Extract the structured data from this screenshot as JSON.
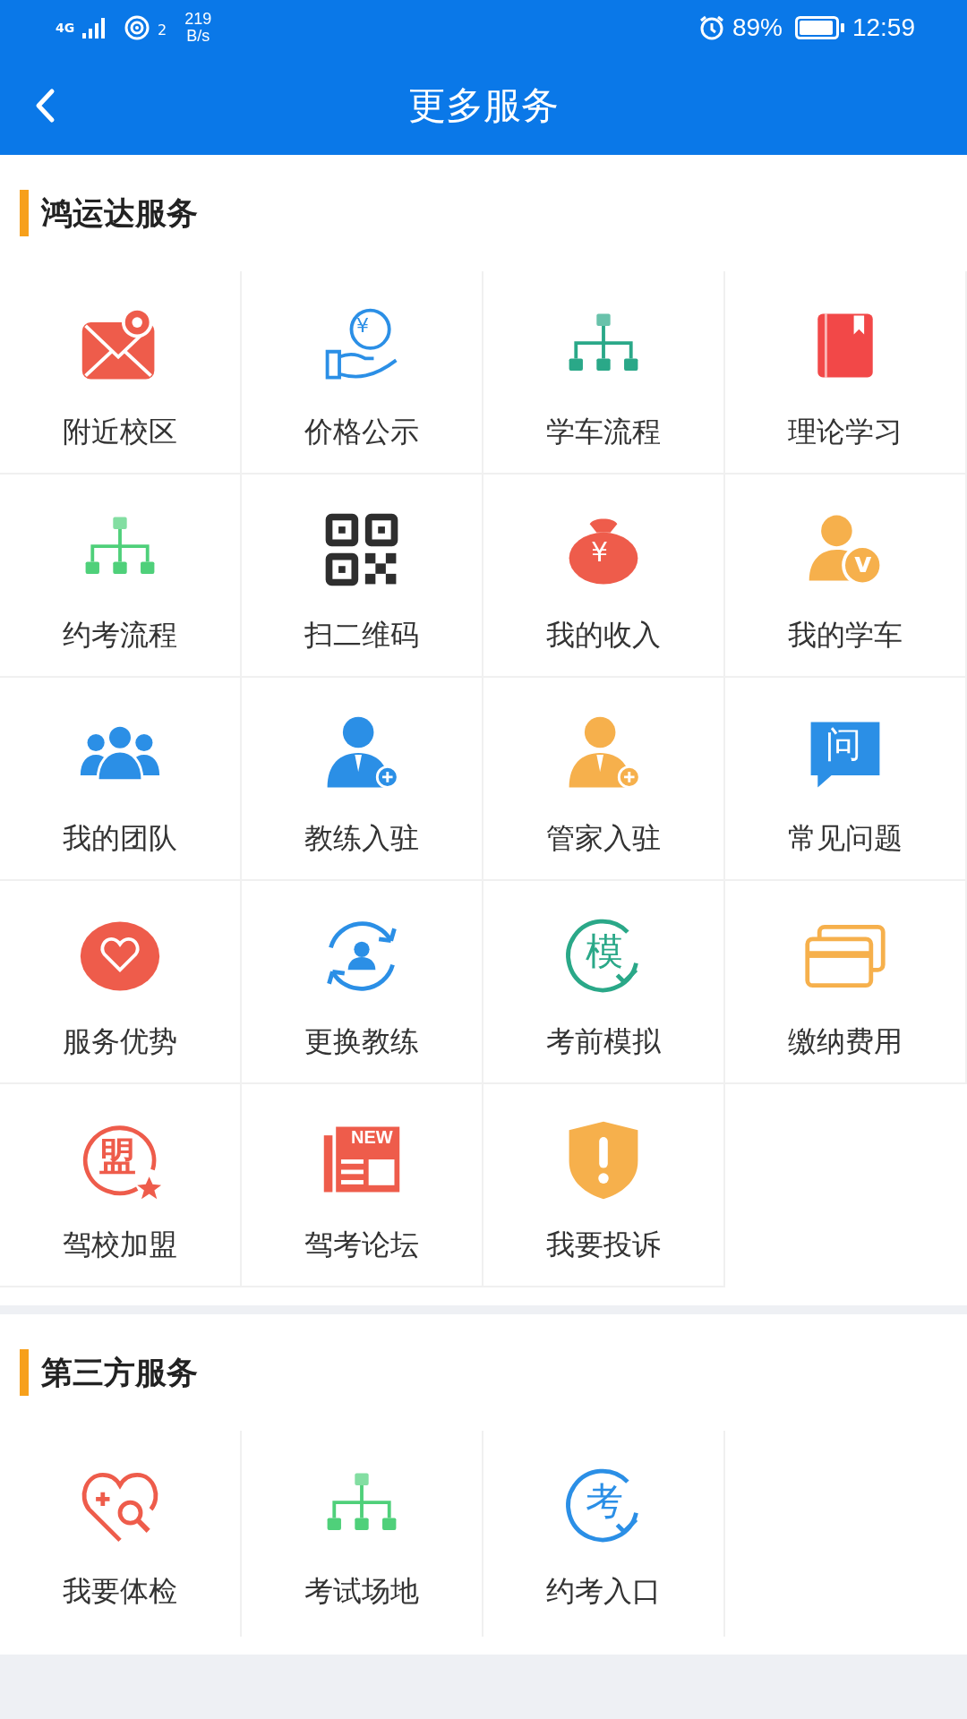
{
  "status_bar": {
    "network": "4G",
    "wifi_sub": "2",
    "speed": "219",
    "speed_unit": "B/s",
    "battery": "89%",
    "time": "12:59"
  },
  "header": {
    "title": "更多服务"
  },
  "sections": [
    {
      "title": "鸿运达服务",
      "items": [
        {
          "label": "附近校区",
          "kind": "map",
          "color": "#ee5c4b"
        },
        {
          "label": "价格公示",
          "kind": "coin-hand",
          "color": "#2b8fe6",
          "glyph": "¥"
        },
        {
          "label": "学车流程",
          "kind": "tree",
          "color": "#2aa888"
        },
        {
          "label": "理论学习",
          "kind": "book",
          "color": "#f24848"
        },
        {
          "label": "约考流程",
          "kind": "tree",
          "color": "#4fd07a"
        },
        {
          "label": "扫二维码",
          "kind": "qr",
          "color": "#2e2e2e"
        },
        {
          "label": "我的收入",
          "kind": "bag",
          "color": "#ee5c4b",
          "glyph": "¥"
        },
        {
          "label": "我的学车",
          "kind": "user-badge",
          "color": "#f6b04c",
          "glyph": "v"
        },
        {
          "label": "我的团队",
          "kind": "team",
          "color": "#2b8fe6"
        },
        {
          "label": "教练入驻",
          "kind": "user-plus",
          "color": "#2b8fe6"
        },
        {
          "label": "管家入驻",
          "kind": "user-plus",
          "color": "#f6b04c"
        },
        {
          "label": "常见问题",
          "kind": "bubble",
          "color": "#2b8fe6",
          "glyph": "问"
        },
        {
          "label": "服务优势",
          "kind": "heart-disc",
          "color": "#ee5c4b"
        },
        {
          "label": "更换教练",
          "kind": "swap-user",
          "color": "#2b8fe6"
        },
        {
          "label": "考前模拟",
          "kind": "ring-glyph",
          "color": "#2aa888",
          "glyph": "模"
        },
        {
          "label": "缴纳费用",
          "kind": "cards",
          "color": "#f6b04c"
        },
        {
          "label": "驾校加盟",
          "kind": "seal",
          "color": "#ee5c4b",
          "glyph": "盟"
        },
        {
          "label": "驾考论坛",
          "kind": "news",
          "color": "#ee5c4b",
          "glyph": "NEW"
        },
        {
          "label": "我要投诉",
          "kind": "shield",
          "color": "#f6b04c"
        }
      ]
    },
    {
      "title": "第三方服务",
      "items": [
        {
          "label": "我要体检",
          "kind": "heart-search",
          "color": "#ee5c4b"
        },
        {
          "label": "考试场地",
          "kind": "tree",
          "color": "#4fd07a"
        },
        {
          "label": "约考入口",
          "kind": "ring-glyph",
          "color": "#2b8fe6",
          "glyph": "考"
        }
      ]
    }
  ]
}
